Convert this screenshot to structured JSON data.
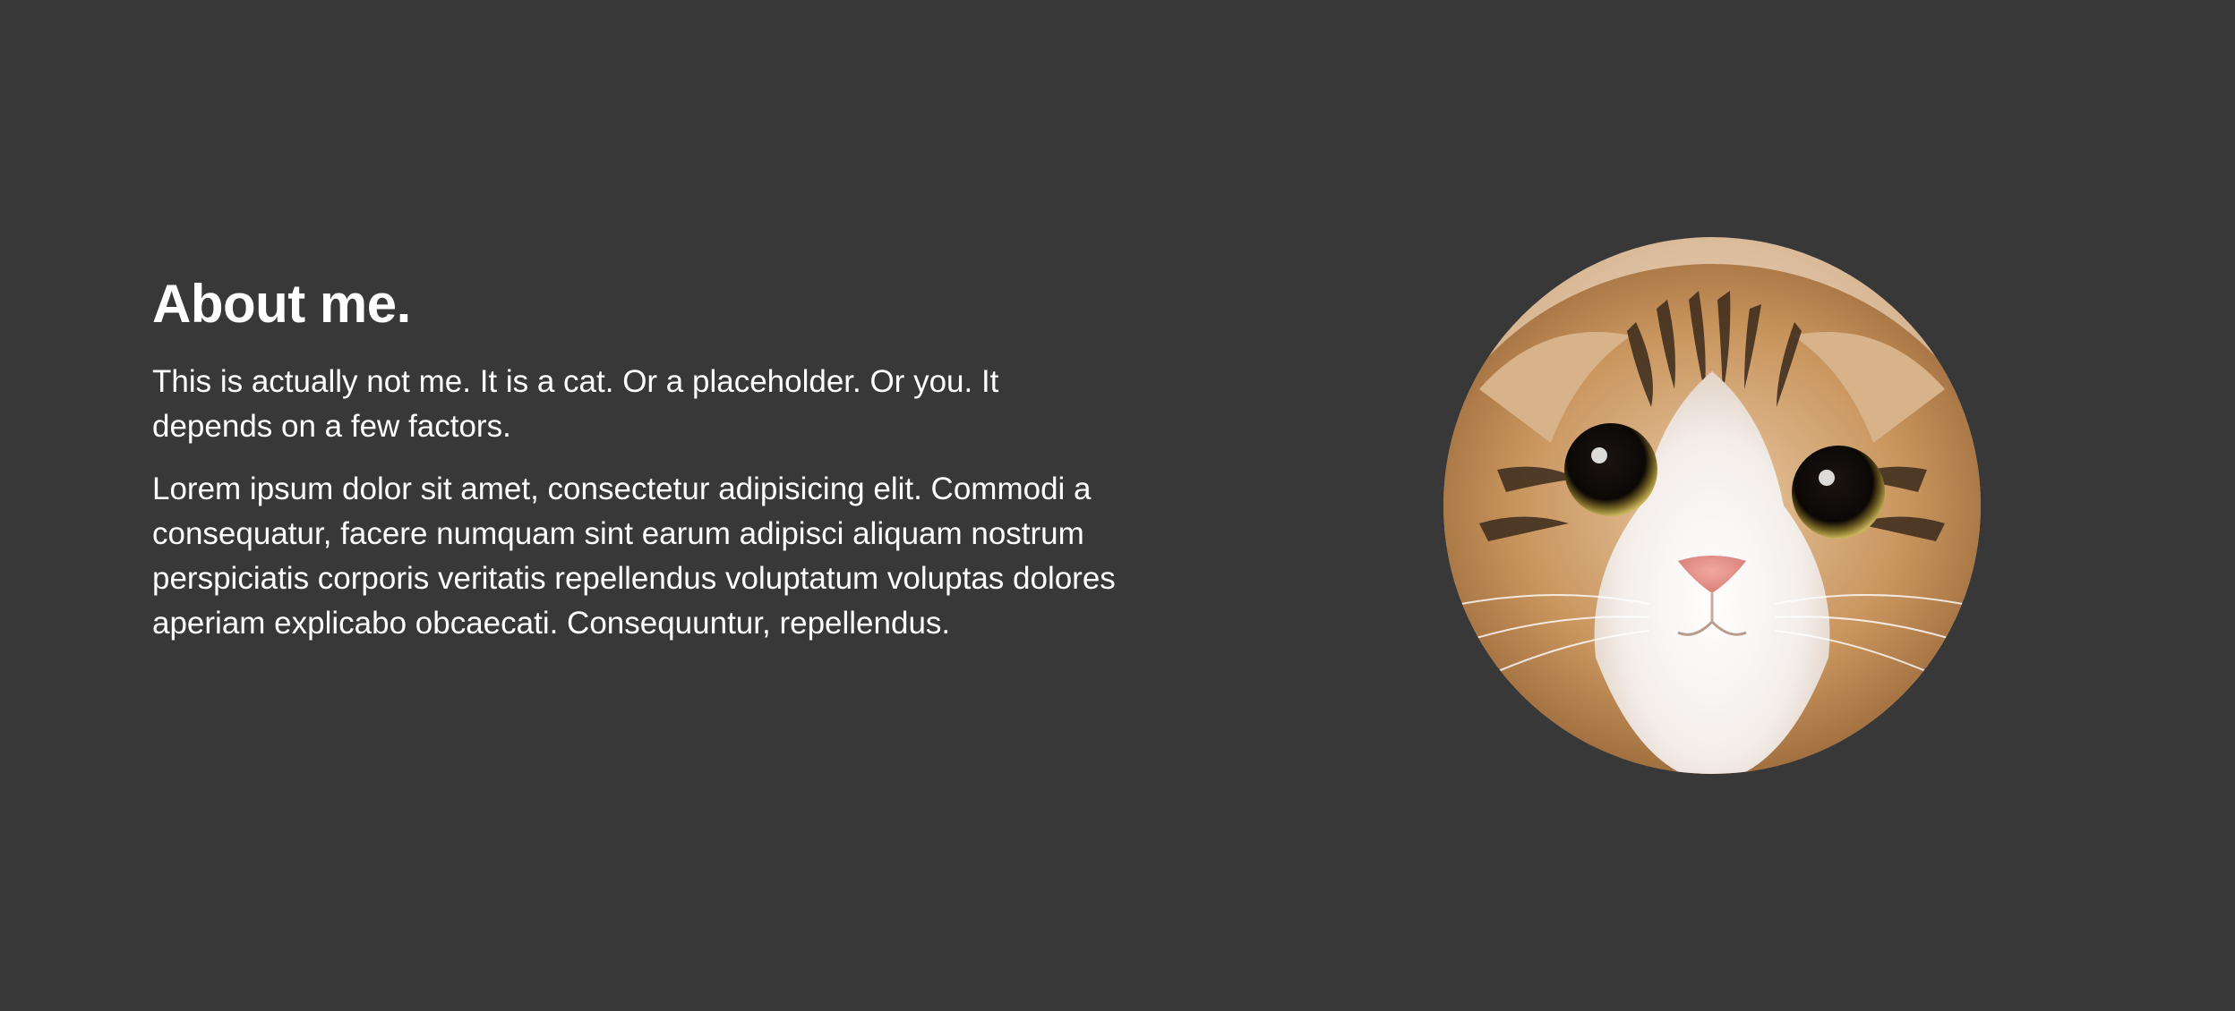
{
  "about": {
    "heading": "About me.",
    "intro": "This is actually not me. It is a cat. Or a placeholder. Or you. It depends on a few factors.",
    "body": "Lorem ipsum dolor sit amet, consectetur adipisicing elit. Commodi a consequatur, facere numquam sint earum adipisci aliquam nostrum perspiciatis corporis veritatis repellendus voluptatum voluptas dolores aperiam explicabo obcaecati. Consequuntur, repellendus."
  },
  "colors": {
    "background": "#383838",
    "text": "#ffffff"
  },
  "avatar": {
    "icon": "cat-face-avatar"
  }
}
